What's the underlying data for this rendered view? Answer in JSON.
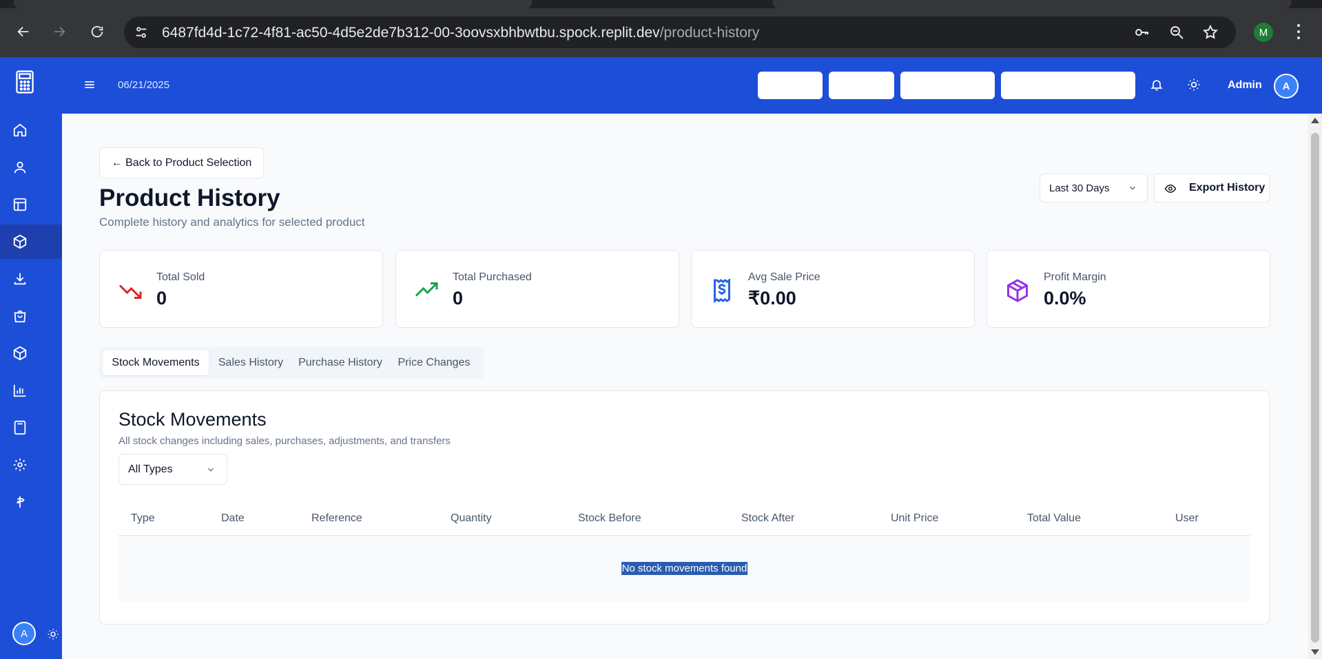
{
  "browser": {
    "url_host": "6487fd4d-1c72-4f81-ac50-4d5e2de7b312-00-3oovsxbhbwtbu.spock.replit.dev",
    "url_path": "/product-history",
    "profile_initial": "M"
  },
  "sidebar": {
    "items": [
      "home-icon",
      "user-icon",
      "layout-icon",
      "package-icon",
      "download-icon",
      "shopping-bag-icon",
      "box-icon",
      "bar-chart-icon",
      "calculator-icon",
      "settings-icon",
      "signpost-icon"
    ],
    "active_index": 3,
    "user_initial": "A"
  },
  "header": {
    "date": "06/21/2025",
    "user_name": "Admin",
    "user_initial": "A"
  },
  "page": {
    "back_label": "← Back to Product Selection",
    "title": "Product History",
    "subtitle": "Complete history and analytics for selected product",
    "range_select": "Last 30 Days",
    "export_label": "Export History"
  },
  "stats": [
    {
      "label": "Total Sold",
      "value": "0",
      "icon": "trending-down-icon",
      "color": "#dc2626"
    },
    {
      "label": "Total Purchased",
      "value": "0",
      "icon": "trending-up-icon",
      "color": "#16a34a"
    },
    {
      "label": "Avg Sale Price",
      "value": "₹0.00",
      "icon": "receipt-icon",
      "color": "#2563eb"
    },
    {
      "label": "Profit Margin",
      "value": "0.0%",
      "icon": "package-icon",
      "color": "#9333ea"
    }
  ],
  "tabs": [
    "Stock Movements",
    "Sales History",
    "Purchase History",
    "Price Changes"
  ],
  "movements": {
    "title": "Stock Movements",
    "subtitle": "All stock changes including sales, purchases, adjustments, and transfers",
    "filter": "All Types",
    "columns": [
      "Type",
      "Date",
      "Reference",
      "Quantity",
      "Stock Before",
      "Stock After",
      "Unit Price",
      "Total Value",
      "User"
    ],
    "empty_message": "No stock movements found"
  },
  "colors": {
    "brand": "#1d4ed8",
    "brand_dark": "#1e40af"
  }
}
